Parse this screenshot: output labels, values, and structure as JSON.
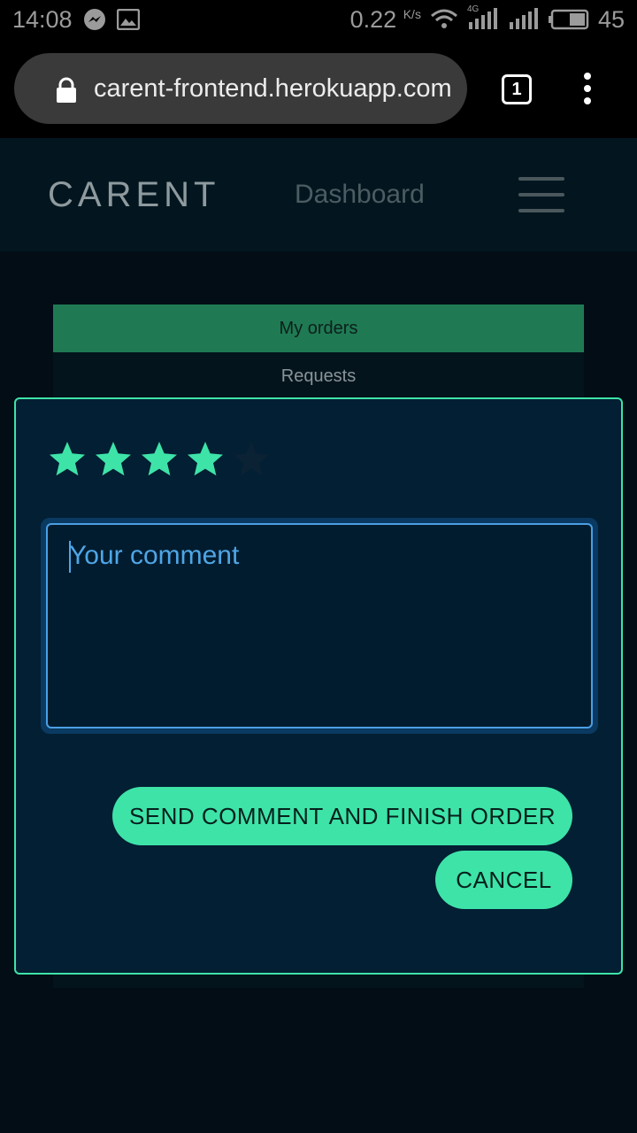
{
  "status_bar": {
    "time": "14:08",
    "speed": "0.22",
    "speed_unit": "K/s",
    "network_type": "4G",
    "battery": "45",
    "icons": [
      "messenger-icon",
      "image-icon",
      "wifi-icon",
      "signal-icon",
      "battery-icon"
    ]
  },
  "browser": {
    "url": "carent-frontend.herokuapp.com",
    "tab_count": "1",
    "icons": [
      "lock-icon",
      "kebab-menu-icon"
    ]
  },
  "header": {
    "brand": "CARENT",
    "nav_link": "Dashboard",
    "menu_icon": "hamburger-icon"
  },
  "tabs": [
    {
      "label": "My orders",
      "active": true
    },
    {
      "label": "Requests",
      "active": false
    }
  ],
  "modal": {
    "rating": {
      "value": 4,
      "max": 5,
      "filled_color": "#3ee3a8",
      "empty_color": "#0a2233"
    },
    "comment": {
      "placeholder": "Your comment",
      "value": ""
    },
    "send_button": "SEND COMMENT AND FINISH ORDER",
    "cancel_button": "CANCEL"
  },
  "colors": {
    "accent": "#3ee3a8",
    "active_tab": "#1f7a53",
    "modal_bg": "#031f33",
    "input_border": "#4c9fe3"
  }
}
